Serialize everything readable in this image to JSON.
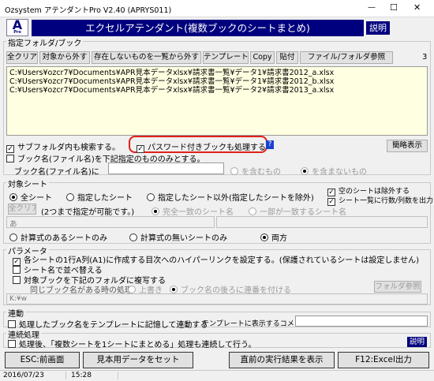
{
  "window": {
    "title": "Ozsystem アテンダントPro V2.40 (APRYS011)",
    "minimize": "—",
    "maximize": "☐",
    "close": "✕"
  },
  "header": {
    "logo_letter": "A",
    "logo_sub": "Pro",
    "title": "エクセルアテンダント(複数ブックのシートまとめ)",
    "help": "説明"
  },
  "book_section": {
    "label": "指定フォルダ/ブック",
    "buttons": [
      "全クリア",
      "対象から外す",
      "存在しないものを一覧から外す",
      "テンプレート",
      "Copy",
      "貼付",
      "ファイル/フォルダ参照"
    ],
    "count": "3",
    "files": [
      "C:¥Users¥ozcr7¥Documents¥APR見本データxlsx¥請求書一覧¥データ1¥請求書2012_a.xlsx",
      "C:¥Users¥ozcr7¥Documents¥APR見本データxlsx¥請求書一覧¥データ1¥請求書2012_b.xlsx",
      "C:¥Users¥ozcr7¥Documents¥APR見本データxlsx¥請求書一覧¥データ2¥請求書2013_a.xlsx"
    ],
    "subfolder": "サブフォルダ内も検索する。",
    "password": "パスワード付きブックも処理する",
    "password_help": "?",
    "simple_view": "簡略表示",
    "filter_name": "ブック名(ファイル名)を下記指定のもののみとする。",
    "book_name_label": "ブック名(ファイル名)に",
    "include": "を含むもの",
    "exclude": "を含まないもの"
  },
  "sheet_section": {
    "label": "対象シート",
    "all": "全シート",
    "specified": "指定したシート",
    "except": "指定したシート以外(指定したシートを除外)",
    "skip_empty": "空のシートは除外する",
    "output_rows": "シート一覧に行数/列数を出力",
    "clear": "全クリア",
    "two_note": "(2つまで指定が可能です。)",
    "exact": "完全一致のシート名",
    "partial": "一部が一致するシート名",
    "input_value": "あ",
    "with_formula": "計算式のあるシートのみ",
    "without_formula": "計算式の無いシートのみ",
    "both": "両方"
  },
  "param_section": {
    "label": "パラメータ",
    "hyperlink": "各シートの1行A列(A1)に作成する目次へのハイパーリンクを設定する。(保護されているシートは設定しません)",
    "sort": "シート名で並べ替える",
    "copy_to_folder": "対象ブックを下記のフォルダに複写する",
    "same_name": "同じブック名がある時の処理",
    "overwrite": "上書き",
    "serial": "ブック名の後ろに連番を付ける",
    "folder_ref": "フォルダ参照",
    "folder_value": "K:¥w"
  },
  "link_section": {
    "label": "連動",
    "record": "処理したブック名をテンプレートに記憶して連動する",
    "comment_label": "テンプレートに表示するコメント"
  },
  "continuous_section": {
    "label": "連続処理",
    "after": "処理後、「複数シートを1シートにまとめる」処理も連続して行う。",
    "help": "説明"
  },
  "footer": {
    "esc": "ESC:前画面",
    "sample": "見本用データをセット",
    "last_result": "直前の実行結果を表示",
    "f12": "F12:Excel出力"
  },
  "status": {
    "date": "2016/07/23",
    "time": "15:28"
  },
  "colors": {
    "header_bg": "#00007e",
    "highlight": "#e0201a",
    "list_bg": "#ffffe1"
  }
}
